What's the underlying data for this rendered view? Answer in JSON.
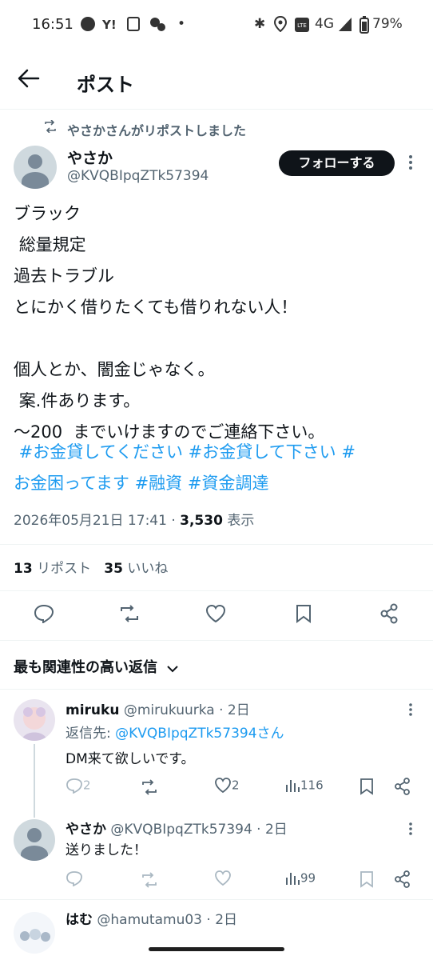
{
  "status_bar": {
    "time": "16:51",
    "battery": "79%",
    "network": "4G"
  },
  "header": {
    "title": "ポスト"
  },
  "post": {
    "repost_label": "やさかさんがリポストしました",
    "author_name": "やさか",
    "author_handle": "@KVQBIpqZTk57394",
    "follow_label": "フォローする",
    "text": "ブラック\n 総量規定\n過去トラブル\nとにかく借りたくても借りれない人！\n\n個人とか、闇金じゃなく。\n 案.件あります。\n〜200  までいけますのでご連絡下さい。",
    "hashtags_line1": " #お金貸してください #お金貸して下さい #",
    "hashtags_line2": "お金困ってます #融資 #資金調達",
    "timestamp": "2026年05月21日 17:41 · ",
    "views_count": "3,530",
    "views_label": " 表示",
    "reposts_count": "13",
    "reposts_label": " リポスト",
    "likes_count": "35",
    "likes_label": " いいね"
  },
  "replies_filter": {
    "label": "最も関連性の高い返信"
  },
  "replies": [
    {
      "name": "miruku",
      "handle": "@mirukuurka · 2日",
      "reply_to_prefix": "返信先: ",
      "reply_to_handle": "@KVQBIpqZTk57394さん",
      "text": "DM来て欲しいです。",
      "comments": "2",
      "likes": "2",
      "views": "116"
    },
    {
      "name": "やさか",
      "handle": "@KVQBIpqZTk57394 · 2日",
      "text": "送りました！",
      "views": "99"
    },
    {
      "name": "はむ",
      "handle": "@hamutamu03 · 2日"
    }
  ],
  "icons": [
    "back-arrow-icon",
    "repost-icon",
    "more-icon",
    "reply-icon",
    "like-icon",
    "bookmark-icon",
    "share-icon",
    "views-icon",
    "chevron-down-icon"
  ]
}
